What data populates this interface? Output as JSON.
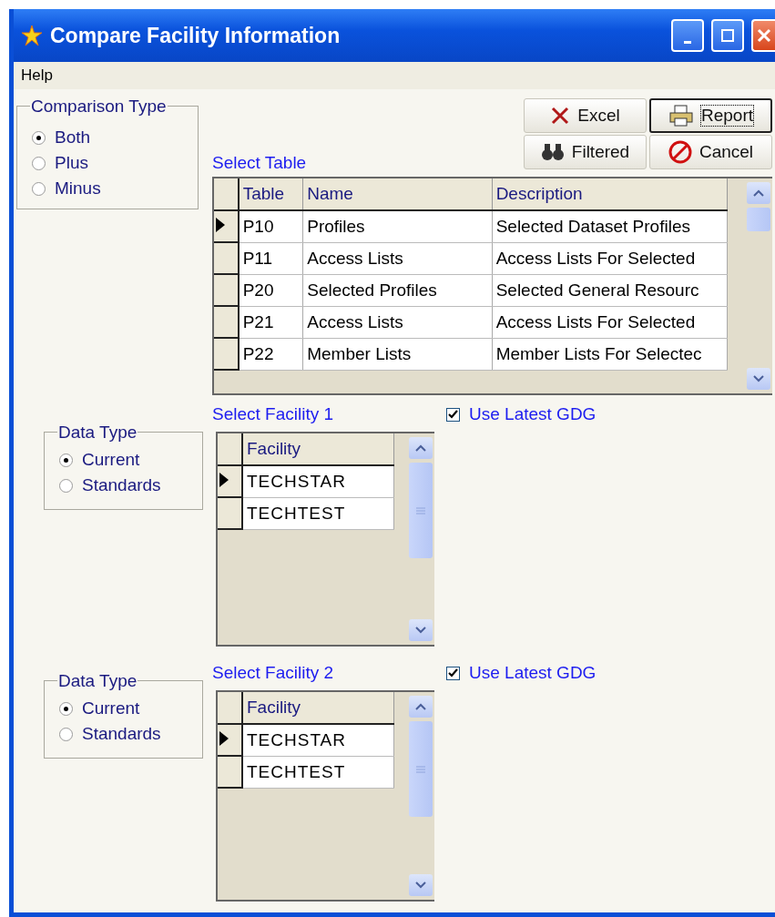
{
  "window": {
    "title": "Compare Facility Information"
  },
  "menu": [
    "Help"
  ],
  "comparison_type": {
    "title": "Comparison Type",
    "options": [
      {
        "label": "Both",
        "selected": true
      },
      {
        "label": "Plus",
        "selected": false
      },
      {
        "label": "Minus",
        "selected": false
      }
    ]
  },
  "buttons": [
    {
      "label": "Excel",
      "kind": "excel",
      "focused": false
    },
    {
      "label": "Report",
      "kind": "report",
      "focused": true
    },
    {
      "label": "Filtered",
      "kind": "filter",
      "focused": false
    },
    {
      "label": "Cancel",
      "kind": "cancel",
      "focused": false
    }
  ],
  "table": {
    "label": "Select Table",
    "columns": [
      "Table",
      "Name",
      "Description"
    ],
    "rows": [
      {
        "cells": [
          "P10",
          "Profiles",
          "Selected Dataset Profiles"
        ],
        "selected": true
      },
      {
        "cells": [
          "P11",
          "Access Lists",
          "Access Lists For Selected"
        ],
        "selected": false
      },
      {
        "cells": [
          "P20",
          "Selected Profiles",
          "Selected General Resourc"
        ],
        "selected": false
      },
      {
        "cells": [
          "P21",
          "Access Lists",
          "Access Lists For Selected"
        ],
        "selected": false
      },
      {
        "cells": [
          "P22",
          "Member Lists",
          "Member Lists For Selectec"
        ],
        "selected": false
      }
    ]
  },
  "facilities": [
    {
      "label": "Select Facility 1",
      "latest_gdg": {
        "label": "Use Latest GDG",
        "checked": true
      },
      "data_type": {
        "title": "Data Type",
        "options": [
          {
            "label": "Current",
            "selected": true
          },
          {
            "label": "Standards",
            "selected": false
          }
        ]
      },
      "grid": {
        "column": "Facility",
        "rows": [
          {
            "name": "TECHSTAR",
            "selected": true
          },
          {
            "name": "TECHTEST",
            "selected": false
          }
        ]
      }
    },
    {
      "label": "Select Facility 2",
      "latest_gdg": {
        "label": "Use Latest GDG",
        "checked": true
      },
      "data_type": {
        "title": "Data Type",
        "options": [
          {
            "label": "Current",
            "selected": true
          },
          {
            "label": "Standards",
            "selected": false
          }
        ]
      },
      "grid": {
        "column": "Facility",
        "rows": [
          {
            "name": "TECHSTAR",
            "selected": true
          },
          {
            "name": "TECHTEST",
            "selected": false
          }
        ]
      }
    }
  ]
}
